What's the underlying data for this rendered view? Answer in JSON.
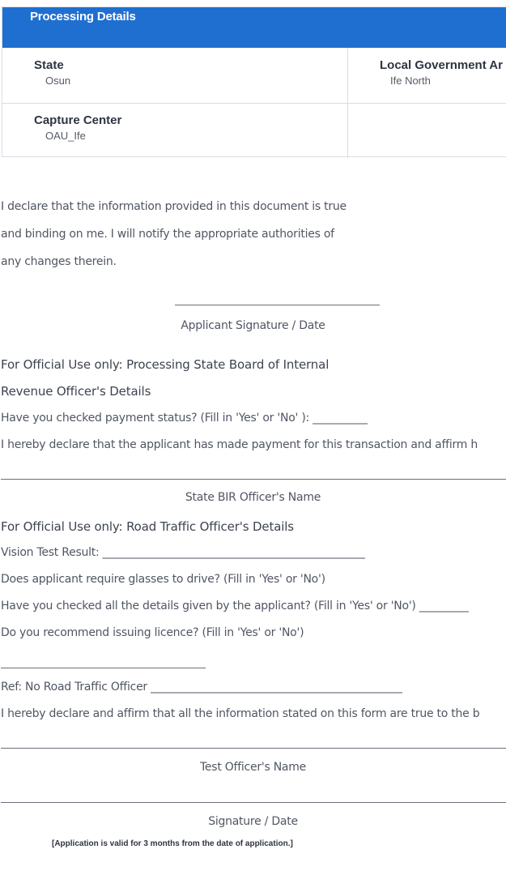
{
  "processing": {
    "title": "Processing Details",
    "state_label": "State",
    "state_value": "Osun",
    "lga_label": "Local Government Ar",
    "lga_value": "Ife North",
    "capture_label": "Capture Center",
    "capture_value": "OAU_Ife"
  },
  "declaration": {
    "line1": "I declare that the information provided in this document is true",
    "line2": "and binding on me. I will notify the appropriate authorities of",
    "line3": "any changes therein.",
    "signature_caption": "Applicant Signature / Date"
  },
  "bir_section": {
    "heading_line1": "For Official Use only: Processing State Board of Internal",
    "heading_line2": "Revenue Officer's Details",
    "payment_question": "Have you checked payment status? (Fill in 'Yes' or 'No' ): __________",
    "payment_declaration": "I hereby declare that the applicant has made payment for this transaction and affirm h",
    "officer_name_caption": "State BIR Officer's Name"
  },
  "road_section": {
    "heading": "For Official Use only: Road Traffic Officer's Details",
    "vision_test": "Vision Test Result: ________________________________________________",
    "glasses_question": "Does applicant require glasses to drive? (Fill in 'Yes' or 'No')",
    "details_question": "Have you checked all the details given by the applicant? (Fill in 'Yes' or 'No') _________",
    "recommend_question": "Do you recommend issuing licence? (Fill in 'Yes' or 'No')",
    "ref_line": "Ref: No Road Traffic Officer ______________________________________________",
    "affirm_line": "I hereby declare and affirm that all the information stated on this form are true to the b",
    "test_officer_caption": "Test Officer's Name",
    "signature_date_caption": "Signature / Date"
  },
  "footer_note": "[Application is valid for 3 months from the date of application.]",
  "colors": {
    "header_bg": "#1f6fd1",
    "border": "#d9dde3",
    "text": "#505663"
  }
}
